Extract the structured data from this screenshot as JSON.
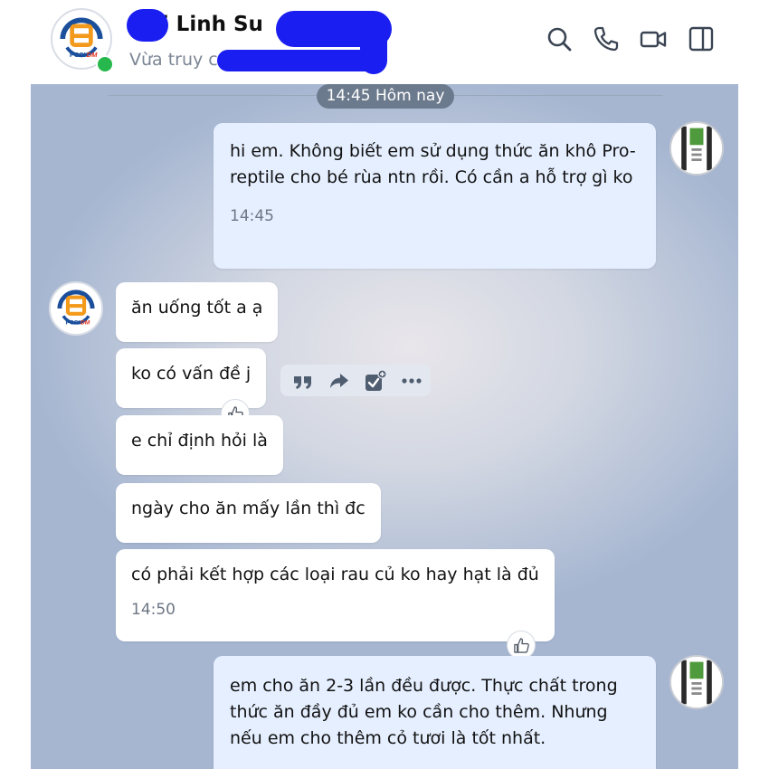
{
  "header": {
    "contact_name": "Hải Linh Su",
    "status": "Vừa truy cập",
    "logo_text": "PCCI",
    "logo_text_accent": "DM",
    "icons": [
      "search-icon",
      "phone-icon",
      "video-call-icon",
      "sidebar-toggle-icon"
    ]
  },
  "colors": {
    "redaction": "#1a1ef0",
    "online": "#27b84d",
    "outgoing_bubble": "#e5efff",
    "incoming_bubble": "#ffffff",
    "logo_blue": "#1b4f9c",
    "logo_orange": "#f39a1d"
  },
  "chat": {
    "date_separator": "14:45 Hôm nay",
    "messages": [
      {
        "direction": "out",
        "text": "hi em. Không biết em sử dụng thức ăn khô Pro-reptile cho bé rùa ntn rồi. Có cần a hỗ trợ gì ko",
        "time": "14:45"
      },
      {
        "direction": "in",
        "text": "ăn uống tốt a ạ"
      },
      {
        "direction": "in",
        "text": "ko có vấn đề j",
        "reaction": "like-icon"
      },
      {
        "direction": "in",
        "text": "e chỉ  định hỏi là"
      },
      {
        "direction": "in",
        "text": "ngày cho ăn mấy lần thì đc"
      },
      {
        "direction": "in",
        "text": "có phải kết hợp các loại rau củ ko hay hạt là đủ",
        "time": "14:50",
        "reaction": "like-icon"
      },
      {
        "direction": "out",
        "text": "em cho ăn 2-3 lần đều được. Thực chất trong thức ăn đầy đủ em ko cần cho thêm. Nhưng nếu em cho thêm cỏ tươi là tốt nhất."
      }
    ],
    "message_toolbar": [
      "quote-icon",
      "forward-icon",
      "add-task-icon",
      "more-icon"
    ]
  }
}
